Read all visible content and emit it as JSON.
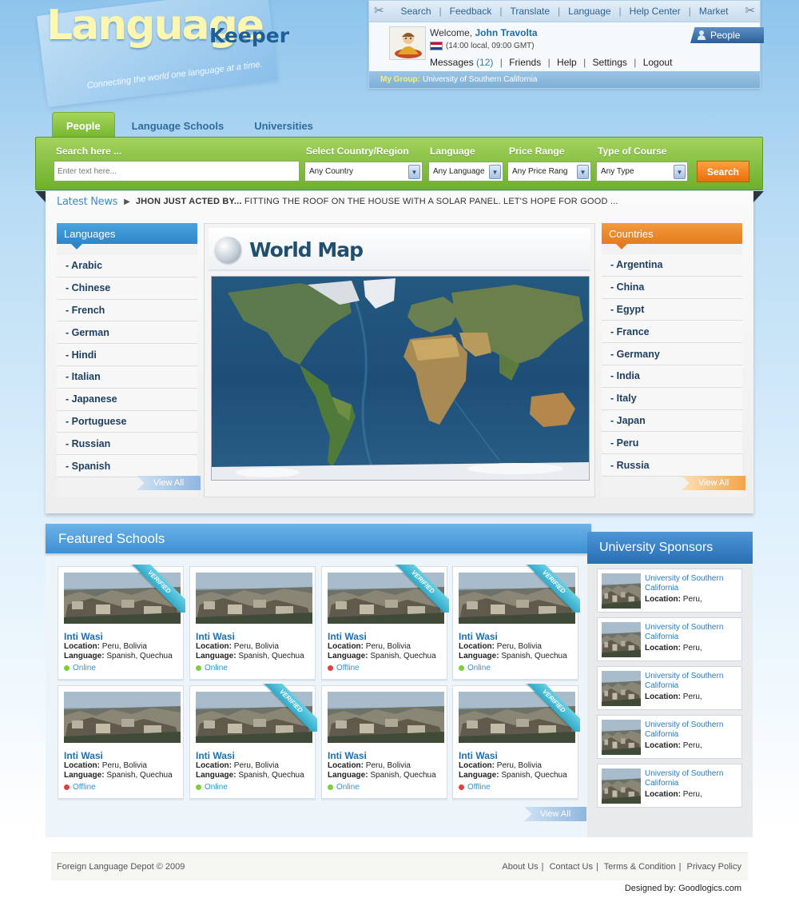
{
  "logo": {
    "main": "Language",
    "sub": "Keeper",
    "tagline": "Connecting the world one language at a time."
  },
  "top_nav": [
    "Search",
    "Feedback",
    "Translate",
    "Language",
    "Help Center",
    "Market"
  ],
  "user": {
    "welcome_label": "Welcome,",
    "name": "John Travolta",
    "local_time": "(14:00 local, 09:00 GMT)",
    "messages_label": "Messages",
    "messages_count": "(12)",
    "links": [
      "Friends",
      "Help",
      "Settings",
      "Logout"
    ],
    "people_tag": "People",
    "group_label": "My Group:",
    "group_value": "University of Southern California"
  },
  "tabs": [
    "People",
    "Language Schools",
    "Universities"
  ],
  "search": {
    "label": "Search here ...",
    "placeholder": "Enter text here...",
    "country_label": "Select Country/Region",
    "country_value": "Any Country",
    "language_label": "Language",
    "language_value": "Any Language",
    "price_label": "Price Range",
    "price_value": "Any Price Rang",
    "course_label": "Type of Course",
    "course_value": "Any Type",
    "button": "Search"
  },
  "news": {
    "title": "Latest News",
    "headline": "JHON JUST ACTED BY...",
    "text": "FITTING THE ROOF ON THE HOUSE WITH A SOLAR PANEL. LET'S HOPE FOR GOOD ..."
  },
  "languages": {
    "title": "Languages",
    "items": [
      "- Arabic",
      "- Chinese",
      "- French",
      "- German",
      "- Hindi",
      "- Italian",
      "- Japanese",
      "- Portuguese",
      "- Russian",
      "- Spanish"
    ],
    "view_all": "View All"
  },
  "map": {
    "title": "World Map"
  },
  "countries": {
    "title": "Countries",
    "items": [
      "- Argentina",
      "- China",
      "- Egypt",
      "- France",
      "- Germany",
      "- India",
      "- Italy",
      "- Japan",
      "- Peru",
      "- Russia"
    ],
    "view_all": "View All"
  },
  "featured": {
    "title": "Featured Schools",
    "verified_label": "VERIFIED",
    "location_label": "Location:",
    "language_label": "Language:",
    "view_all": "View All",
    "schools": [
      {
        "name": "Inti Wasi",
        "location": "Peru, Bolivia",
        "language": "Spanish, Quechua",
        "status": "Online",
        "verified": true
      },
      {
        "name": "Inti Wasi",
        "location": "Peru, Bolivia",
        "language": "Spanish, Quechua",
        "status": "Online",
        "verified": false
      },
      {
        "name": "Inti Wasi",
        "location": "Peru, Bolivia",
        "language": "Spanish, Quechua",
        "status": "Offline",
        "verified": true
      },
      {
        "name": "Inti Wasi",
        "location": "Peru, Bolivia",
        "language": "Spanish, Quechua",
        "status": "Online",
        "verified": true
      },
      {
        "name": "Inti Wasi",
        "location": "Peru, Bolivia",
        "language": "Spanish, Quechua",
        "status": "Offline",
        "verified": false
      },
      {
        "name": "Inti Wasi",
        "location": "Peru, Bolivia",
        "language": "Spanish, Quechua",
        "status": "Online",
        "verified": true
      },
      {
        "name": "Inti Wasi",
        "location": "Peru, Bolivia",
        "language": "Spanish, Quechua",
        "status": "Online",
        "verified": false
      },
      {
        "name": "Inti Wasi",
        "location": "Peru, Bolivia",
        "language": "Spanish, Quechua",
        "status": "Offline",
        "verified": true
      }
    ]
  },
  "sponsors": {
    "title": "University Sponsors",
    "location_label": "Location:",
    "items": [
      {
        "name": "University of Southern California",
        "location": "Peru,"
      },
      {
        "name": "University of Southern California",
        "location": "Peru,"
      },
      {
        "name": "University of Southern California",
        "location": "Peru,"
      },
      {
        "name": "University of Southern California",
        "location": "Peru,"
      },
      {
        "name": "University of Southern California",
        "location": "Peru,"
      }
    ]
  },
  "footer": {
    "copyright": "Foreign Language Depot © 2009",
    "links": [
      "About Us",
      "Contact Us",
      "Terms & Condition",
      "Privacy Policy"
    ],
    "designed_by": "Designed by: Goodlogics.com"
  },
  "colors": {
    "accent_green": "#74b52a",
    "accent_blue": "#2e86c8",
    "accent_orange": "#e57c1c",
    "online": "#7ccf3a",
    "offline": "#e04040"
  },
  "icons": [
    "pushpin-icon",
    "avatar",
    "flag-icon",
    "person-icon",
    "dropdown-arrow-icon",
    "play-arrow-icon",
    "globe-icon",
    "status-dot-icon"
  ]
}
